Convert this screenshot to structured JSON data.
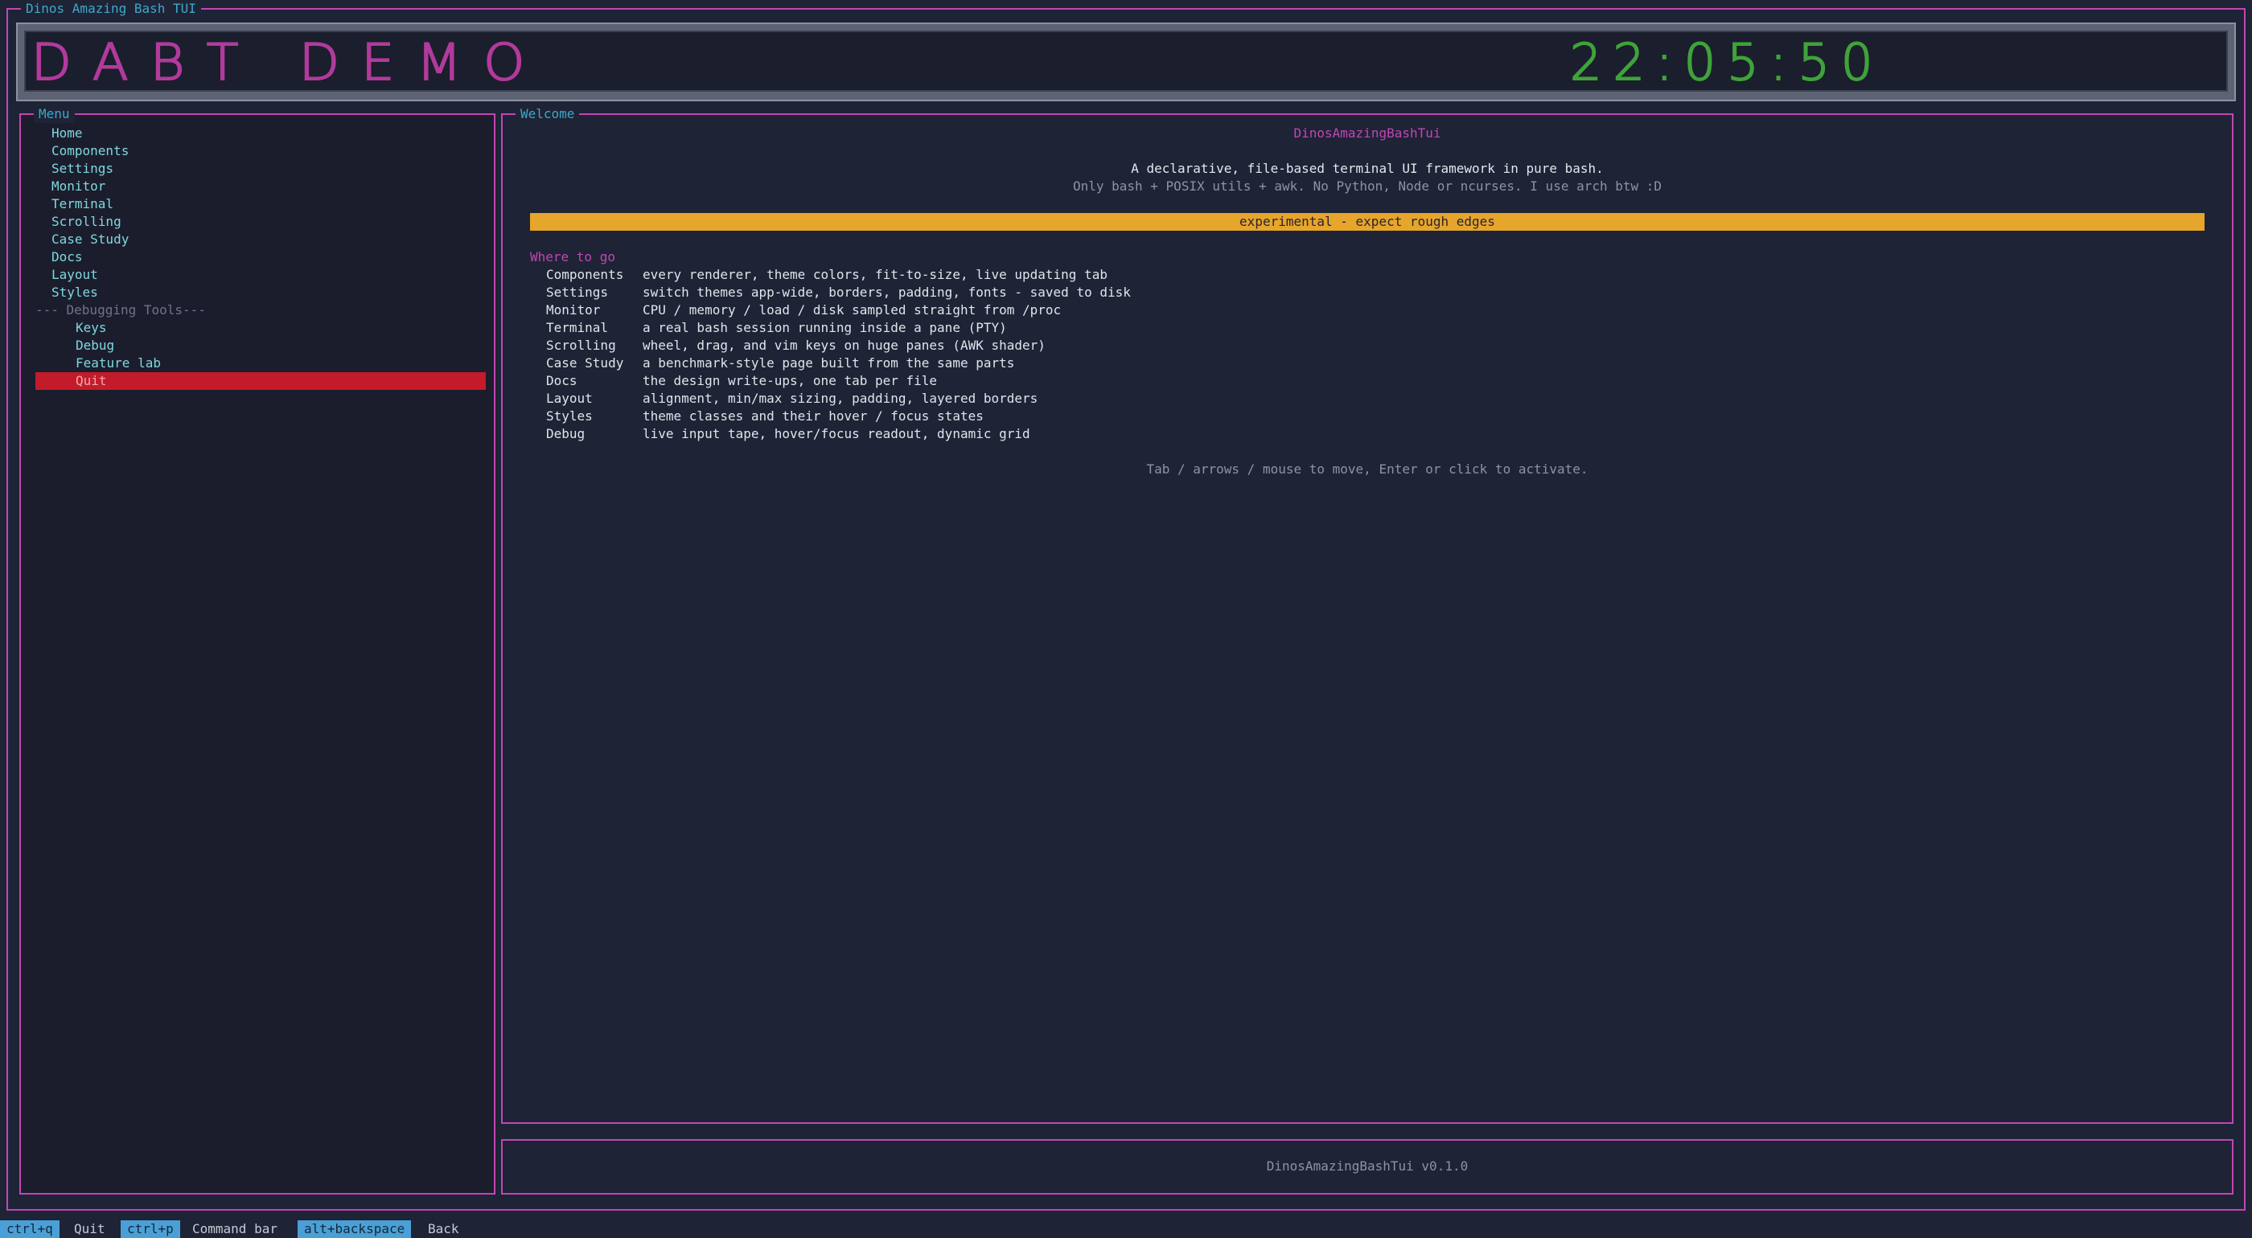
{
  "app": {
    "title": "Dinos Amazing Bash TUI"
  },
  "header": {
    "logo": "DABT DEMO",
    "clock": "22:05:50"
  },
  "menu": {
    "title": "Menu",
    "items": [
      "Home",
      "Components",
      "Settings",
      "Monitor",
      "Terminal",
      "Scrolling",
      "Case Study",
      "Docs",
      "Layout",
      "Styles"
    ],
    "separator": "--- Debugging Tools---",
    "debug_items": [
      "Keys",
      "Debug",
      "Feature lab"
    ],
    "quit": "Quit"
  },
  "welcome": {
    "panel_title": "Welcome",
    "title": "DinosAmazingBashTui",
    "tagline": "A declarative, file-based terminal UI framework in pure bash.",
    "tagline2": "Only bash + POSIX utils + awk. No Python, Node or ncurses. I use arch btw :D",
    "banner": "experimental - expect rough edges",
    "where_title": "Where to go",
    "rows": [
      {
        "name": "Components",
        "desc": "every renderer, theme colors, fit-to-size, live updating tab"
      },
      {
        "name": "Settings",
        "desc": "switch themes app-wide, borders, padding, fonts - saved to disk"
      },
      {
        "name": "Monitor",
        "desc": "CPU / memory / load / disk sampled straight from /proc"
      },
      {
        "name": "Terminal",
        "desc": "a real bash session running inside a pane (PTY)"
      },
      {
        "name": "Scrolling",
        "desc": "wheel, drag, and vim keys on huge panes (AWK shader)"
      },
      {
        "name": "Case Study",
        "desc": "a benchmark-style page built from the same parts"
      },
      {
        "name": "Docs",
        "desc": "the design write-ups, one tab per file"
      },
      {
        "name": "Layout",
        "desc": "alignment, min/max sizing, padding, layered borders"
      },
      {
        "name": "Styles",
        "desc": "theme classes and their hover / focus states"
      },
      {
        "name": "Debug",
        "desc": "live input tape, hover/focus readout, dynamic grid"
      }
    ],
    "hint": "Tab / arrows / mouse to move, Enter or click to activate."
  },
  "footer": {
    "version": "DinosAmazingBashTui v0.1.0"
  },
  "statusbar": [
    {
      "key": "ctrl+q",
      "label": "Quit"
    },
    {
      "key": "ctrl+p",
      "label": "Command bar"
    },
    {
      "key": "alt+backspace",
      "label": "Back"
    }
  ]
}
